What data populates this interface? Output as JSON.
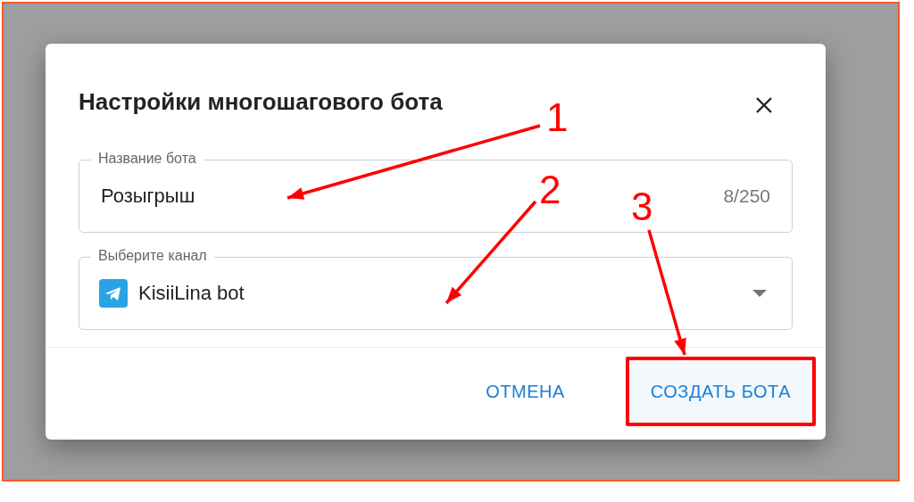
{
  "dialog": {
    "title": "Настройки многошагового бота",
    "name_field": {
      "label": "Название бота",
      "value": "Розыгрыш",
      "counter": "8/250"
    },
    "channel_field": {
      "label": "Выберите канал",
      "value": "KisiiLina bot"
    },
    "buttons": [
      {
        "label": "ОТМЕНА",
        "highlighted": false
      },
      {
        "label": "СОЗДАТЬ БОТА",
        "highlighted": true
      }
    ]
  },
  "annotations": [
    {
      "label": "1"
    },
    {
      "label": "2"
    },
    {
      "label": "3"
    }
  ]
}
